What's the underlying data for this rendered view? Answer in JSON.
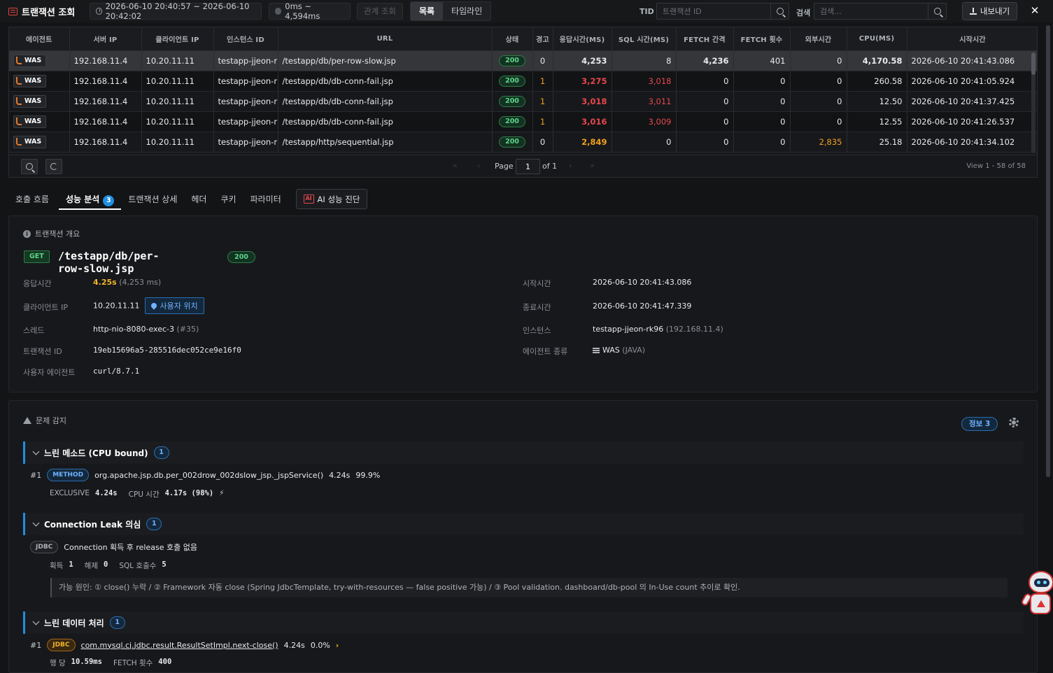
{
  "topbar": {
    "title": "트랜잭션 조회",
    "time_range": "2026-06-10 20:40:57 ~ 2026-06-10 20:42:02",
    "duration_range": "0ms ~ 4,594ms",
    "related_btn": "관계 조회",
    "view_list": "목록",
    "view_timeline": "타임라인",
    "tid_label": "TID",
    "tid_placeholder": "트랜잭션 ID",
    "search_label": "검색",
    "search_placeholder": "검색...",
    "export_label": "내보내기",
    "close_label": "✕"
  },
  "table": {
    "columns": [
      "에이전트",
      "서버 IP",
      "클라이언트 IP",
      "인스턴스 ID",
      "URL",
      "상태",
      "경고",
      "응답시간(MS)",
      "SQL 시간(MS)",
      "FETCH 간격",
      "FETCH 횟수",
      "외부시간",
      "CPU(MS)",
      "시작시간"
    ],
    "rows": [
      {
        "agent": "WAS",
        "server_ip": "192.168.11.4",
        "client_ip": "10.20.11.11",
        "instance": "testapp-jjeon-rk96",
        "url": "/testapp/db/per-row-slow.jsp",
        "status": "200",
        "warn": "0",
        "resp": "4,253",
        "sql": "8",
        "fetch_gap": "4,236",
        "fetch_cnt": "401",
        "ext": "0",
        "cpu": "4,170.58",
        "start": "2026-06-10 20:41:43.086"
      },
      {
        "agent": "WAS",
        "server_ip": "192.168.11.4",
        "client_ip": "10.20.11.11",
        "instance": "testapp-jjeon-rk96",
        "url": "/testapp/db/db-conn-fail.jsp",
        "status": "200",
        "warn": "1",
        "resp": "3,275",
        "sql": "3,018",
        "fetch_gap": "0",
        "fetch_cnt": "0",
        "ext": "0",
        "cpu": "260.58",
        "start": "2026-06-10 20:41:05.924"
      },
      {
        "agent": "WAS",
        "server_ip": "192.168.11.4",
        "client_ip": "10.20.11.11",
        "instance": "testapp-jjeon-rk96",
        "url": "/testapp/db/db-conn-fail.jsp",
        "status": "200",
        "warn": "1",
        "resp": "3,018",
        "sql": "3,011",
        "fetch_gap": "0",
        "fetch_cnt": "0",
        "ext": "0",
        "cpu": "12.50",
        "start": "2026-06-10 20:41:37.425"
      },
      {
        "agent": "WAS",
        "server_ip": "192.168.11.4",
        "client_ip": "10.20.11.11",
        "instance": "testapp-jjeon-rk96",
        "url": "/testapp/db/db-conn-fail.jsp",
        "status": "200",
        "warn": "1",
        "resp": "3,016",
        "sql": "3,009",
        "fetch_gap": "0",
        "fetch_cnt": "0",
        "ext": "0",
        "cpu": "12.55",
        "start": "2026-06-10 20:41:26.537"
      },
      {
        "agent": "WAS",
        "server_ip": "192.168.11.4",
        "client_ip": "10.20.11.11",
        "instance": "testapp-jjeon-rk96",
        "url": "/testapp/http/sequential.jsp",
        "status": "200",
        "warn": "0",
        "resp": "2,849",
        "sql": "0",
        "fetch_gap": "0",
        "fetch_cnt": "0",
        "ext": "2,835",
        "cpu": "25.18",
        "start": "2026-06-10 20:41:34.102"
      }
    ]
  },
  "pager": {
    "page_label": "Page",
    "page_value": "1",
    "of_label": "of 1",
    "view_count": "View 1 - 58 of 58"
  },
  "tabs": {
    "call_flow": "호출 흐름",
    "perf_analysis": "성능 분석",
    "perf_count": "3",
    "tx_detail": "트랜잭션 상세",
    "header": "헤더",
    "cookie": "쿠키",
    "params": "파라미터",
    "ai_label": "AI 성능 진단",
    "ai_icon": "AI"
  },
  "overview": {
    "section_title": "트랜잭션 개요",
    "method": "GET",
    "url": "/testapp/db/per-row-slow.jsp",
    "status": "200",
    "resp_label": "응답시간",
    "resp_value": "4.25s",
    "resp_sub": "(4,253 ms)",
    "client_ip_label": "클라이언트 IP",
    "client_ip_value": "10.20.11.11",
    "user_loc_btn": "사용자 위치",
    "thread_label": "스레드",
    "thread_value": "http-nio-8080-exec-3",
    "thread_sub": "(#35)",
    "txid_label": "트랜잭션 ID",
    "txid_value": "19eb15696a5-285516dec052ce9e16f0",
    "ua_label": "사용자 에이전트",
    "ua_value": "curl/8.7.1",
    "start_label": "시작시간",
    "start_value": "2026-06-10 20:41:43.086",
    "end_label": "종료시간",
    "end_value": "2026-06-10 20:41:47.339",
    "instance_label": "인스턴스",
    "instance_value": "testapp-jjeon-rk96",
    "instance_sub": "(192.168.11.4)",
    "agent_type_label": "에이전트 종류",
    "agent_type_value": "WAS",
    "agent_type_sub": "(JAVA)"
  },
  "problems": {
    "section_title": "문제 감지",
    "info_pill": "정보 3",
    "items": [
      {
        "title": "느린 메소드 (CPU bound)",
        "count": "1",
        "rank": "#1",
        "tag": "METHOD",
        "text": "org.apache.jsp.db.per_002drow_002dslow_jsp._jspService()",
        "v1": "4.24s",
        "v2": "99.9%",
        "m1_label": "EXCLUSIVE",
        "m1_value": "4.24s",
        "m2_label": "CPU 시간",
        "m2_value": "4.17s (98%)",
        "m2_icon": "⚡"
      },
      {
        "title": "Connection Leak 의심",
        "count": "1",
        "tag": "JDBC",
        "text": "Connection 획득 후 release 호출 없음",
        "m1_label": "획득",
        "m1_value": "1",
        "m2_label": "해제",
        "m2_value": "0",
        "m3_label": "SQL 호출수",
        "m3_value": "5",
        "cause": "가능 원인: ① close() 누락 / ② Framework 자동 close (Spring JdbcTemplate, try-with-resources — false positive 가능) / ③ Pool validation. dashboard/db-pool 의 In-Use count 추이로 확인."
      },
      {
        "title": "느린 데이터 처리",
        "count": "1",
        "rank": "#1",
        "tag": "JDBC",
        "text": "com.mysql.cj.jdbc.result.ResultSetImpl.next-close()",
        "v1": "4.24s",
        "v2": "0.0%",
        "arrow": "›",
        "m1_label": "행 당",
        "m1_value": "10.59ms",
        "m2_label": "FETCH 횟수",
        "m2_value": "400"
      }
    ]
  }
}
